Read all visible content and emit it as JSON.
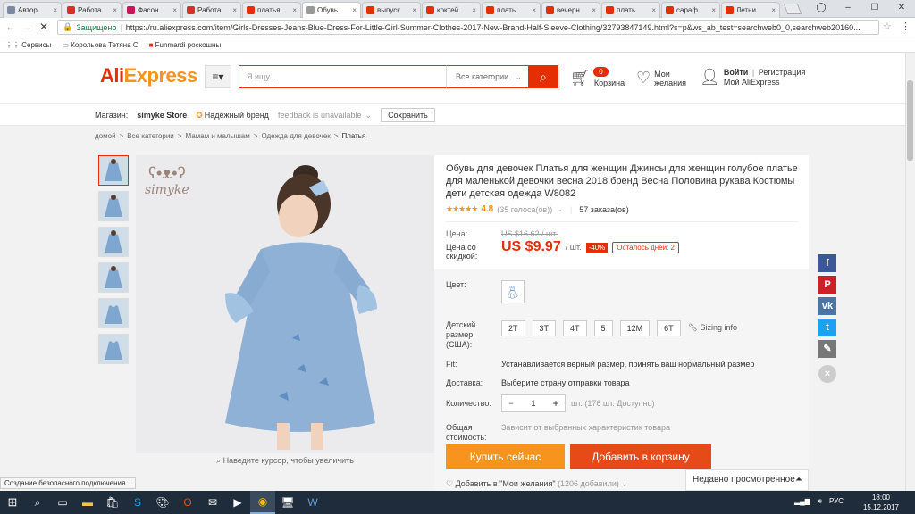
{
  "browser": {
    "tabs": [
      {
        "title": "Автор",
        "color": "#7a8aa0",
        "icon": "user-icon",
        "active": false
      },
      {
        "title": "Работа",
        "color": "#d93025",
        "icon": "gmail-icon",
        "active": false
      },
      {
        "title": "Фасон",
        "color": "#c2185b",
        "icon": "pinterest-icon",
        "active": false
      },
      {
        "title": "Работа",
        "color": "#d93025",
        "icon": "gmail-icon",
        "active": false
      },
      {
        "title": "платья",
        "color": "#e62e04",
        "icon": "aliexpress-icon",
        "active": false
      },
      {
        "title": "Обувь",
        "color": "#999999",
        "icon": "loading-icon",
        "active": true
      },
      {
        "title": "выпуск",
        "color": "#e62e04",
        "icon": "aliexpress-icon",
        "active": false
      },
      {
        "title": "коктей",
        "color": "#e62e04",
        "icon": "aliexpress-icon",
        "active": false
      },
      {
        "title": "плать",
        "color": "#e62e04",
        "icon": "aliexpress-icon",
        "active": false
      },
      {
        "title": "вечерн",
        "color": "#e62e04",
        "icon": "aliexpress-icon",
        "active": false
      },
      {
        "title": "плать",
        "color": "#e62e04",
        "icon": "aliexpress-icon",
        "active": false
      },
      {
        "title": "сараф",
        "color": "#e62e04",
        "icon": "aliexpress-icon",
        "active": false
      },
      {
        "title": "Летни",
        "color": "#e62e04",
        "icon": "aliexpress-icon",
        "active": false
      }
    ],
    "secure_label": "Защищено",
    "url": "https://ru.aliexpress.com/item/Girls-Dresses-Jeans-Blue-Dress-For-Little-Girl-Summer-Clothes-2017-New-Brand-Half-Sleeve-Clothing/32793847149.html?s=p&ws_ab_test=searchweb0_0,searchweb20160...",
    "bookmarks": [
      {
        "label": "Сервисы",
        "icon": "apps-icon"
      },
      {
        "label": "Корольова Тетяна С",
        "icon": "bookmark-icon"
      },
      {
        "label": "Funmardi роскошны",
        "icon": "aliexpress-icon"
      }
    ]
  },
  "header": {
    "logo_left": "Ali",
    "logo_right": "Express",
    "search_placeholder": "Я ищу...",
    "category_select": "Все категории",
    "cart_count": "0",
    "cart_label": "Корзина",
    "wish_label_1": "Мои",
    "wish_label_2": "желания",
    "login": "Войти",
    "register": "Регистрация",
    "my_account": "Мой AliExpress"
  },
  "store": {
    "label": "Магазин:",
    "name": "simyke Store",
    "badge": "Надёжный бренд",
    "feedback": "feedback is unavailable",
    "save": "Сохранить"
  },
  "breadcrumb": [
    "домой",
    ">",
    "Все категории",
    ">",
    "Мамам и малышам",
    ">",
    "Одежда для девочек",
    ">",
    "Платья"
  ],
  "gallery": {
    "brand": "simyke",
    "zoom_hint": "Наведите курсор, чтобы увеличить",
    "thumb_count": 6
  },
  "product": {
    "title": "Обувь для девочек Платья для женщин Джинсы для женщин голубое платье для маленькой девочки весна 2018 бренд Весна Половина рукава Костюмы дети детская одежда W8082",
    "rating": "4.8",
    "rating_fraction": 0.96,
    "votes": "(35 голоса(ов))",
    "orders": "57 заказа(ов)",
    "price_label": "Цена:",
    "old_price": "US $16.62 / шт.",
    "discount_label_1": "Цена со",
    "discount_label_2": "скидкой:",
    "price": "US $9.97",
    "price_unit": "/ шт.",
    "discount": "-40%",
    "days_left": "Осталось дней: 2",
    "color_label": "Цвет:",
    "size_label_1": "Детский",
    "size_label_2": "размер",
    "size_label_3": "(США):",
    "sizes": [
      "2T",
      "3T",
      "4T",
      "5",
      "12M",
      "6T"
    ],
    "sizing_info": "Sizing info",
    "fit_label": "Fit:",
    "fit_text": "Устанавливается верный размер, принять ваш нормальный размер",
    "delivery_label": "Доставка:",
    "delivery_text": "Выберите страну отправки товара",
    "qty_label": "Количество:",
    "qty": "1",
    "qty_minus": "−",
    "qty_plus": "+",
    "stock": "шт. (176 шт. Доступно)",
    "total_label_1": "Общая",
    "total_label_2": "стоимость:",
    "total_text": "Зависит от выбранных характеристик товара",
    "buy_now": "Купить сейчас",
    "add_cart": "Добавить в корзину",
    "wishlist": "Добавить в \"Мои желания\"",
    "wishlist_count": "(1206 добавили)"
  },
  "colors": {
    "accent": "#e62e04",
    "orange": "#f7931e",
    "buy_btn": "#f7941d",
    "cart_btn": "#e64a19"
  },
  "social": [
    {
      "icon": "facebook-icon",
      "glyph": "f",
      "color": "#3b5998"
    },
    {
      "icon": "pinterest-icon",
      "glyph": "P",
      "color": "#cb2027"
    },
    {
      "icon": "vk-icon",
      "glyph": "vk",
      "color": "#4c75a3"
    },
    {
      "icon": "twitter-icon",
      "glyph": "t",
      "color": "#1da1f2"
    },
    {
      "icon": "pencil-icon",
      "glyph": "✎",
      "color": "#777777"
    },
    {
      "icon": "close-icon",
      "glyph": "×",
      "color": "#cccccc"
    }
  ],
  "recently_viewed": "Недавно просмотренное",
  "status_text": "Создание безопасного подключения...",
  "taskbar": {
    "lang": "РУС",
    "time": "18:00",
    "date": "15.12.2017"
  }
}
